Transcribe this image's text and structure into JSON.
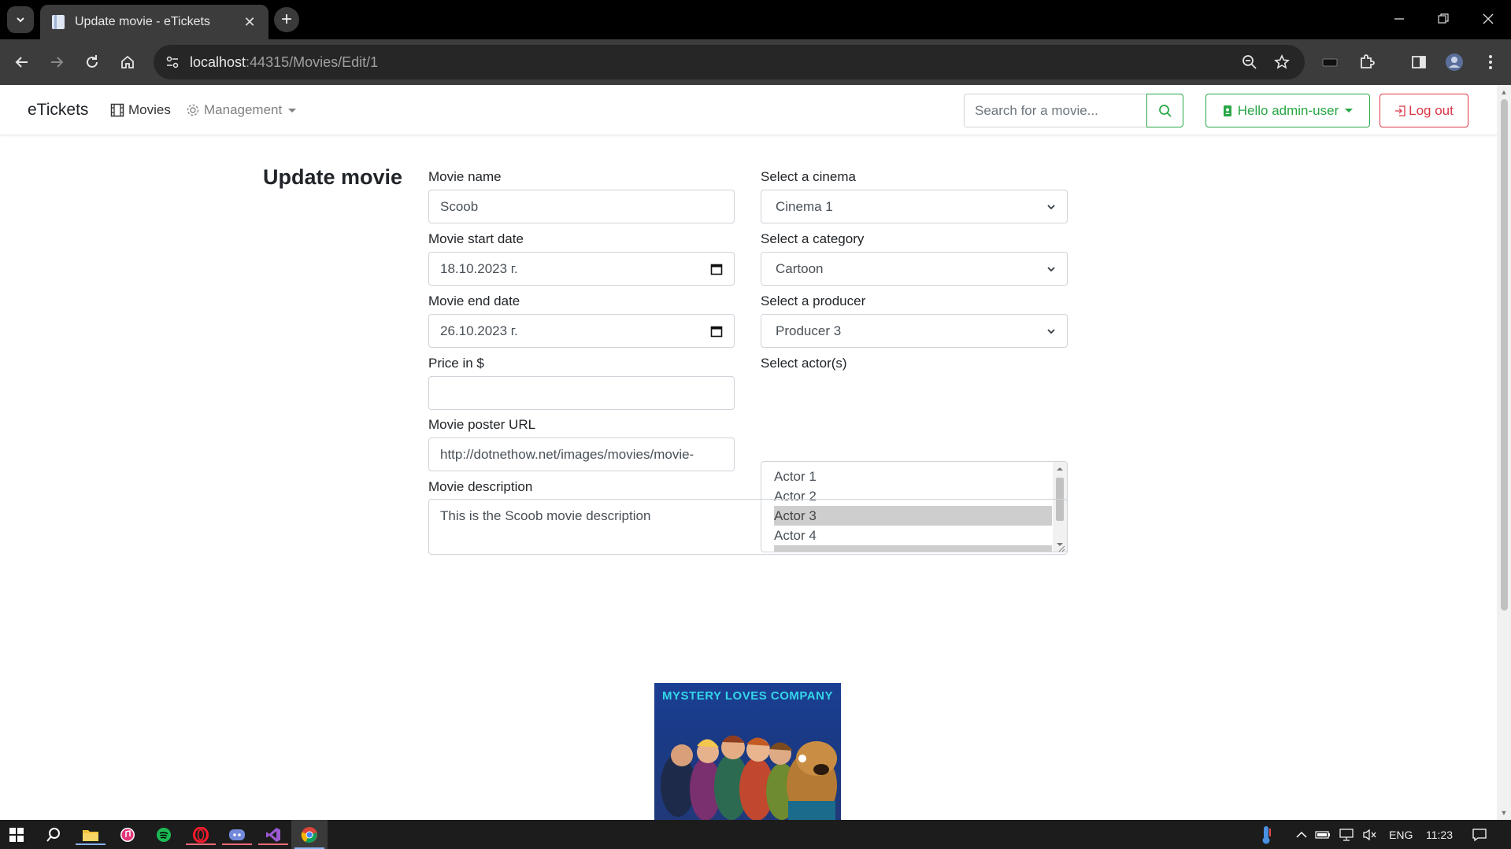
{
  "browser": {
    "tab_title": "Update movie - eTickets",
    "url_host": "localhost",
    "url_rest": ":44315/Movies/Edit/1"
  },
  "nav": {
    "brand": "eTickets",
    "movies": "Movies",
    "management": "Management",
    "search_placeholder": "Search for a movie...",
    "user_button": "Hello admin-user",
    "logout": "Log out"
  },
  "form": {
    "title": "Update movie",
    "name_label": "Movie name",
    "name_value": "Scoob",
    "start_label": "Movie start date",
    "start_value": "18.10.2023 г.",
    "end_label": "Movie end date",
    "end_value": "26.10.2023 г.",
    "price_label": "Price in $",
    "price_value": "",
    "poster_label": "Movie poster URL",
    "poster_value": "http://dotnethow.net/images/movies/movie-",
    "cinema_label": "Select a cinema",
    "cinema_value": "Cinema 1",
    "category_label": "Select a category",
    "category_value": "Cartoon",
    "producer_label": "Select a producer",
    "producer_value": "Producer 3",
    "actors_label": "Select actor(s)",
    "actors": [
      "Actor 1",
      "Actor 2",
      "Actor 3",
      "Actor 4"
    ],
    "desc_label": "Movie description",
    "desc_value": "This is the Scoob movie description",
    "poster_image_text": "MYSTERY LOVES COMPANY"
  },
  "taskbar": {
    "language": "ENG",
    "time": "11:23"
  },
  "colors": {
    "success": "#28a745",
    "danger": "#dc3545",
    "selected_option": "#cecece"
  }
}
